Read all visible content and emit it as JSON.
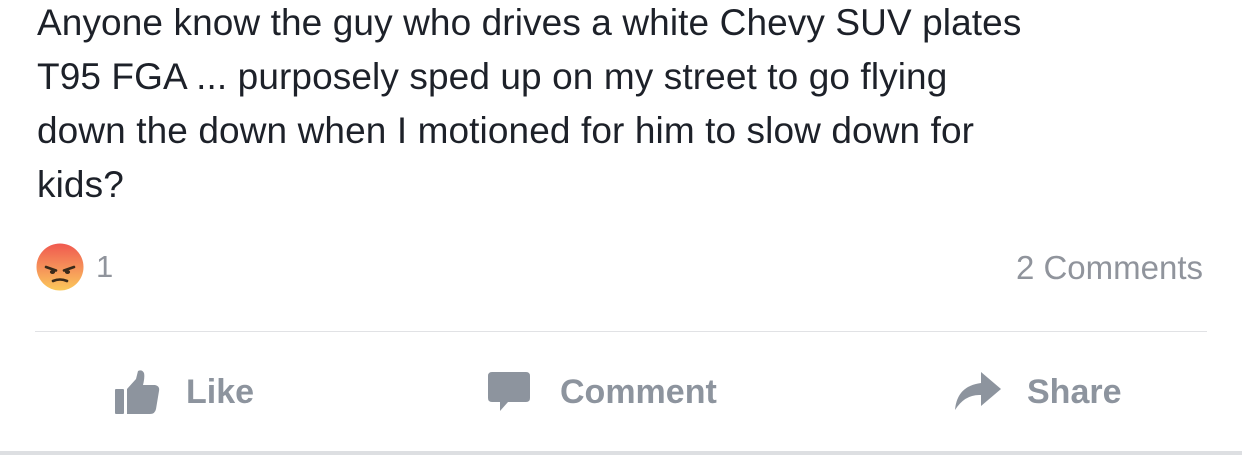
{
  "post": {
    "text_lines": [
      "Anyone know the guy who drives a white Chevy SUV plates",
      "T95 FGA ... purposely sped up on my street to go flying",
      "down the down when I motioned for him to slow down for",
      "kids?"
    ]
  },
  "reactions": {
    "icon": "angry-reaction-icon",
    "count": "1"
  },
  "comments": {
    "count_label": "2 Comments"
  },
  "actions": {
    "like_label": "Like",
    "comment_label": "Comment",
    "share_label": "Share"
  },
  "colors": {
    "text": "#1d2129",
    "muted": "#90949c",
    "action": "#8d949e",
    "divider": "#e1e2e5",
    "angry_top": "#f0594f",
    "angry_bottom": "#fbc95a"
  }
}
